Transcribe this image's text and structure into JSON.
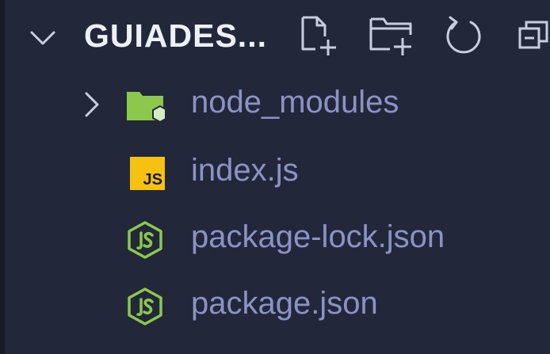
{
  "explorer": {
    "title": "GUIADES...",
    "actions": [
      {
        "name": "new-file",
        "icon": "new-file-icon"
      },
      {
        "name": "new-folder",
        "icon": "new-folder-icon"
      },
      {
        "name": "refresh",
        "icon": "refresh-icon"
      },
      {
        "name": "collapse-all",
        "icon": "collapse-all-icon"
      }
    ],
    "items": [
      {
        "label": "node_modules",
        "type": "folder",
        "icon": "node-folder-icon"
      },
      {
        "label": "index.js",
        "type": "file",
        "icon": "js-file-icon",
        "badge": "JS"
      },
      {
        "label": "package-lock.json",
        "type": "file",
        "icon": "nodejs-icon"
      },
      {
        "label": "package.json",
        "type": "file",
        "icon": "nodejs-icon"
      }
    ]
  },
  "colors": {
    "background": "#23273a",
    "title": "#eef0f8",
    "label": "#8b93c4",
    "icon_stroke": "#c9cde0",
    "node_green": "#8cc84b",
    "js_yellow": "#f5c211"
  }
}
